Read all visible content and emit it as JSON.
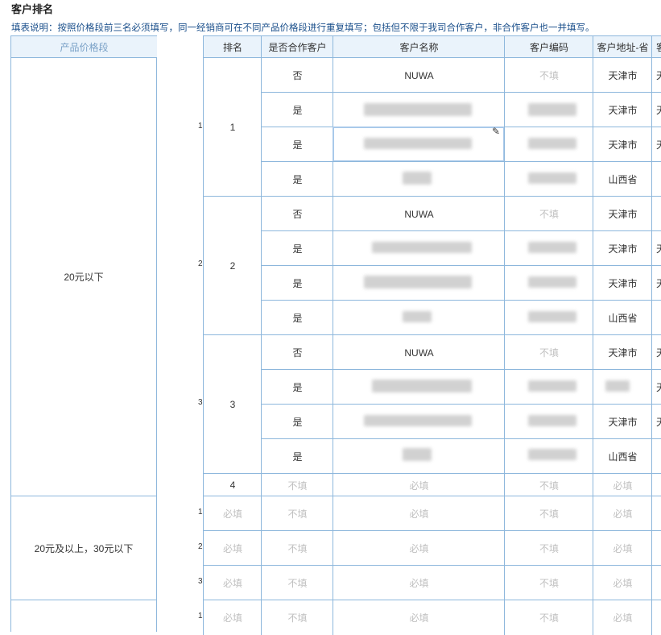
{
  "page": {
    "title": "客户排名",
    "note": "填表说明：按照价格段前三名必须填写，同一经销商可在不同产品价格段进行重复填写；包括但不限于我司合作客户，非合作客户也一并填写。"
  },
  "columns": {
    "price_band": "产品价格段",
    "rank": "排名",
    "is_partner": "是否合作客户",
    "customer_name": "客户名称",
    "customer_code": "客户编码",
    "customer_province": "客户地址-省",
    "extra_col_fragment": "客"
  },
  "groups": [
    {
      "price_band": "20元以下",
      "ranks": [
        {
          "index": "1",
          "rank": "1",
          "rows": [
            {
              "is_partner": "否",
              "customer_name": "NUWA",
              "customer_code": "不填",
              "province": "天津市",
              "extra": "天"
            },
            {
              "is_partner": "是",
              "customer_name": "",
              "customer_code": "",
              "province": "天津市",
              "extra": "天"
            },
            {
              "is_partner": "是",
              "customer_name": "",
              "customer_code": "",
              "province": "天津市",
              "extra": "天"
            },
            {
              "is_partner": "是",
              "customer_name": "",
              "customer_code": "",
              "province": "山西省",
              "extra": ""
            }
          ]
        },
        {
          "index": "2",
          "rank": "2",
          "rows": [
            {
              "is_partner": "否",
              "customer_name": "NUWA",
              "customer_code": "不填",
              "province": "天津市",
              "extra": ""
            },
            {
              "is_partner": "是",
              "customer_name": "",
              "customer_code": "",
              "province": "天津市",
              "extra": "天"
            },
            {
              "is_partner": "是",
              "customer_name": "",
              "customer_code": "",
              "province": "天津市",
              "extra": "天"
            },
            {
              "is_partner": "是",
              "customer_name": "",
              "customer_code": "",
              "province": "山西省",
              "extra": ""
            }
          ]
        },
        {
          "index": "3",
          "rank": "3",
          "rows": [
            {
              "is_partner": "否",
              "customer_name": "NUWA",
              "customer_code": "不填",
              "province": "天津市",
              "extra": "天"
            },
            {
              "is_partner": "是",
              "customer_name": "",
              "customer_code": "",
              "province": "",
              "extra": "天"
            },
            {
              "is_partner": "是",
              "customer_name": "",
              "customer_code": "",
              "province": "天津市",
              "extra": "天"
            },
            {
              "is_partner": "是",
              "customer_name": "",
              "customer_code": "",
              "province": "山西省",
              "extra": ""
            }
          ]
        }
      ],
      "rank4": {
        "rank": "4",
        "is_partner": "不填",
        "customer_name": "必填",
        "customer_code": "不填",
        "province": "必填"
      }
    },
    {
      "price_band": "20元及以上，30元以下",
      "rows": [
        {
          "index": "1",
          "rank": "必填",
          "is_partner": "不填",
          "customer_name": "必填",
          "customer_code": "不填",
          "province": "必填"
        },
        {
          "index": "2",
          "rank": "必填",
          "is_partner": "不填",
          "customer_name": "必填",
          "customer_code": "不填",
          "province": "必填"
        },
        {
          "index": "3",
          "rank": "必填",
          "is_partner": "不填",
          "customer_name": "必填",
          "customer_code": "不填",
          "province": "必填"
        }
      ]
    },
    {
      "price_band": "",
      "rows": [
        {
          "index": "1",
          "rank": "必填",
          "is_partner": "不填",
          "customer_name": "必填",
          "customer_code": "不填",
          "province": "必填"
        }
      ]
    }
  ]
}
